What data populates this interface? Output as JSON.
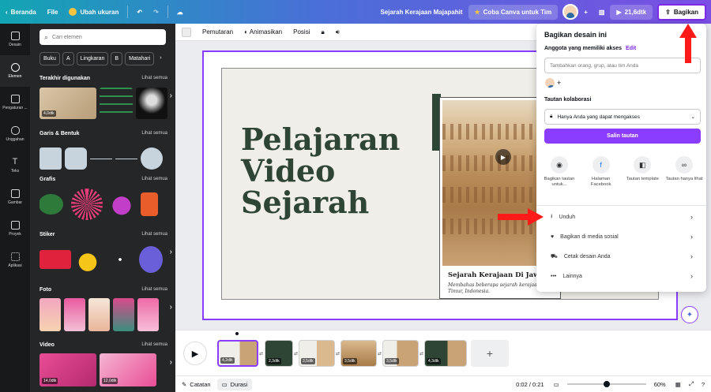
{
  "topbar": {
    "home_label": "Beranda",
    "file_label": "File",
    "resize_label": "Ubah ukuran",
    "doc_title": "Sejarah Kerajaan Majapahit",
    "team_label": "Coba Canva untuk Tim",
    "play_label": "21,6dtk",
    "share_label": "Bagikan"
  },
  "rail": {
    "items": [
      {
        "label": "Desain"
      },
      {
        "label": "Elemen"
      },
      {
        "label": "Pengaturan ..."
      },
      {
        "label": "Unggahan"
      },
      {
        "label": "Teks"
      },
      {
        "label": "Gambar"
      },
      {
        "label": "Proyek"
      },
      {
        "label": "Aplikasi"
      }
    ]
  },
  "panel": {
    "search_placeholder": "Cari elemen",
    "chips": [
      "Buku",
      "A",
      "Lingkaran",
      "B",
      "Matahari"
    ],
    "see_all": "Lihat semua",
    "sections": {
      "recent": {
        "title": "Terakhir digunakan",
        "duration": "4,0dtk"
      },
      "lines": {
        "title": "Garis & Bentuk"
      },
      "graphics": {
        "title": "Grafis"
      },
      "stickers": {
        "title": "Stiker"
      },
      "photos": {
        "title": "Foto"
      },
      "videos": {
        "title": "Video",
        "durations": [
          "14,0dtk",
          "12,0dtk"
        ]
      }
    }
  },
  "context_bar": {
    "animation_label": "Pemutaran",
    "animate_label": "Animasikan",
    "position_label": "Posisi"
  },
  "canvas": {
    "title_line1": "Pelajaran",
    "title_line2": "Video",
    "title_line3": "Sejarah",
    "caption_title": "Sejarah Kerajaan Di Jawa",
    "caption_sub": "Membahas beberapa sejarah kerajaan-k Timur, Indonesia."
  },
  "timeline": {
    "clips": [
      {
        "duration": "4,2dtk"
      },
      {
        "duration": "2,3dtk"
      },
      {
        "duration": "3,5dtk"
      },
      {
        "duration": "3,5dtk"
      },
      {
        "duration": "3,5dtk"
      },
      {
        "duration": "4,3dtk"
      }
    ]
  },
  "bottombar": {
    "notes_label": "Catatan",
    "duration_label": "Durasi",
    "time": "0:02 / 0:21",
    "zoom": "60%"
  },
  "share_popup": {
    "title": "Bagikan desain ini",
    "access_label": "Anggota yang memiliki akses",
    "edit_label": "Edit",
    "input_placeholder": "Tambahkan orang, grup, atau tim Anda",
    "collab_label": "Tautan kolaborasi",
    "access_option": "Hanya Anda yang dapat mengakses",
    "copy_button": "Salin tautan",
    "options": [
      {
        "label": "Bagikan tautan untuk..."
      },
      {
        "label": "Halaman Facebook"
      },
      {
        "label": "Tautan template"
      },
      {
        "label": "Tautan hanya lihat"
      }
    ],
    "rows": [
      {
        "label": "Unduh"
      },
      {
        "label": "Bagikan di media sosial"
      },
      {
        "label": "Cetak desain Anda"
      },
      {
        "label": "Lainnya"
      }
    ]
  },
  "colors": {
    "brand_purple": "#8b3dff",
    "title_green": "#2e4535",
    "annotation_red": "#ff1a1a"
  }
}
